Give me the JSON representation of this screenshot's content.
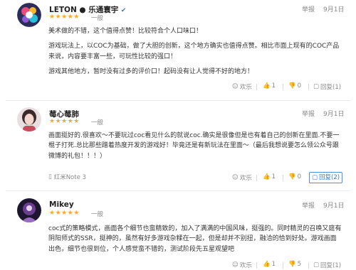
{
  "reviews": [
    {
      "name": "LETON ● 乐通寰宇",
      "verified": true,
      "stars": "★★★★★",
      "tag": "一般",
      "report": "举报",
      "date": "9月1日",
      "paragraphs": [
        "美术做的不错，这个值得点赞！比较符合个人口味口！",
        "游戏玩法上，以COC为基础，做了大胆的创新，这个地方确实也值得点赞。相比市面上现有的COC产品来说，内容要丰富一些，可玩性比较的强口！",
        "游戏其他地方，暂时没有过多的评价口！起码没有让人觉得不好的地方！"
      ],
      "device": "",
      "actions": {
        "joy": "欢乐",
        "like": "1",
        "dislike": "0",
        "reply": "回复(1)"
      }
    },
    {
      "name": "莓心莓肺",
      "verified": false,
      "stars": "★★★★★",
      "tag": "一般",
      "report": "举报",
      "date": "9月1日",
      "paragraphs": [
        "画面挺好的.很喜欢～不要玩过coc看见什么的就说coc.确实是很像但是也有着自己的创新在里面.不要一棍子打死.总比那些蹭着热度开发的游戏好！毕竟还是有新玩法在里面～（最后我想说要怎么领公众号跟微博的礼包！！！）"
      ],
      "device": "红米Note 3",
      "actions": {
        "joy": "欢乐",
        "like": "1",
        "dislike": "0",
        "reply": "回复(2)"
      }
    },
    {
      "name": "Mikey",
      "verified": false,
      "stars": "★★★★★",
      "tag": "一般",
      "report": "举报",
      "date": "9月1日",
      "paragraphs": [
        "coc式的策略模式，画面各个细节也蛮精致的，加入了满满的中国风味，挺强的。同时精灵的召唤又庭有阴阳师式的SSR，挺神的，虽然有好多游戏杂糅在一起，但是却并不别扭，融洽的恰到好处。游戏画面出色，细节也很到位，个人感觉蛮不错的，测试阶段先五星观望吧"
      ],
      "device": "",
      "actions": {
        "joy": "欢乐",
        "like": "1",
        "dislike": "5",
        "reply": "回复(1)"
      }
    }
  ],
  "colors": {
    "star": "#f2a93b",
    "verified": "#3a7ac8",
    "reply_active": "#4d8fd8"
  }
}
